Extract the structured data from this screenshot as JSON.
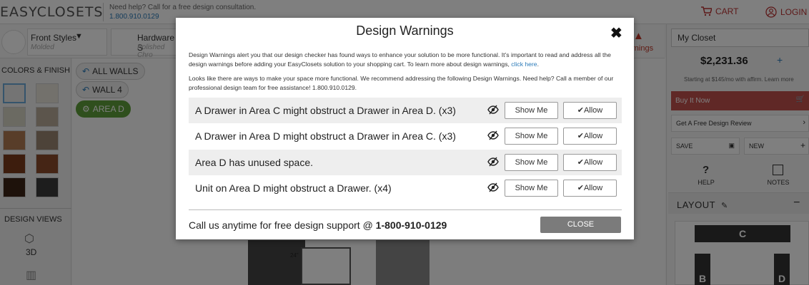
{
  "header": {
    "logo": "EASYCLOSETS",
    "help_text": "Need help? Call for a free design consultation.",
    "help_phone": "1.800.910.0129",
    "cart_label": "CART",
    "login_label": "LOGIN"
  },
  "toolbar": {
    "front_styles_label": "Front Styles",
    "front_styles_sub": "Molded",
    "hardware_label": "Hardware S",
    "hardware_sub": "Polished Chro",
    "warnings_fragment": "arnings"
  },
  "left_panel": {
    "colors_title": "COLORS & FINISH",
    "design_views_title": "DESIGN VIEWS",
    "view_3d_label": "3D"
  },
  "area_pills": {
    "all_walls": "ALL WALLS",
    "wall_4": "WALL 4",
    "area_d": "AREA D"
  },
  "right_panel": {
    "closet_name": "My Closet",
    "price": "$2,231.36",
    "affirm_text": "Starting at $145/mo with affirm. Learn more",
    "buy_now": "Buy It Now",
    "design_review": "Get A Free Design Review",
    "save": "SAVE",
    "new": "NEW",
    "help": "HELP",
    "notes": "NOTES",
    "layout": "LAYOUT"
  },
  "modal": {
    "title": "Design Warnings",
    "intro_text": "Design Warnings alert you that our design checker has found ways to enhance your solution to be more functional. It’s important to read and address all the design warnings before adding your EasyClosets solution to your shopping cart. To learn more about design warnings,",
    "intro_link": "click here",
    "intro_end": ".",
    "help_text": "Looks like there are ways to make your space more functional. We recommend addressing the following Design Warnings. Need help? Call a member of our professional design team for free assistance! 1.800.910.0129.",
    "show_me_label": "Show Me",
    "allow_label": "Allow",
    "warnings": [
      {
        "text": "A Drawer in Area C might obstruct a Drawer in Area D. (x3)"
      },
      {
        "text": "A Drawer in Area D might obstruct a Drawer in Area C. (x3)"
      },
      {
        "text": "Area D has unused space."
      },
      {
        "text": "Unit on Area D might obstruct a Drawer. (x4)"
      }
    ],
    "footer_text": "Call us anytime for free design support @ ",
    "footer_phone": "1-800-910-0129",
    "close_label": "CLOSE"
  }
}
